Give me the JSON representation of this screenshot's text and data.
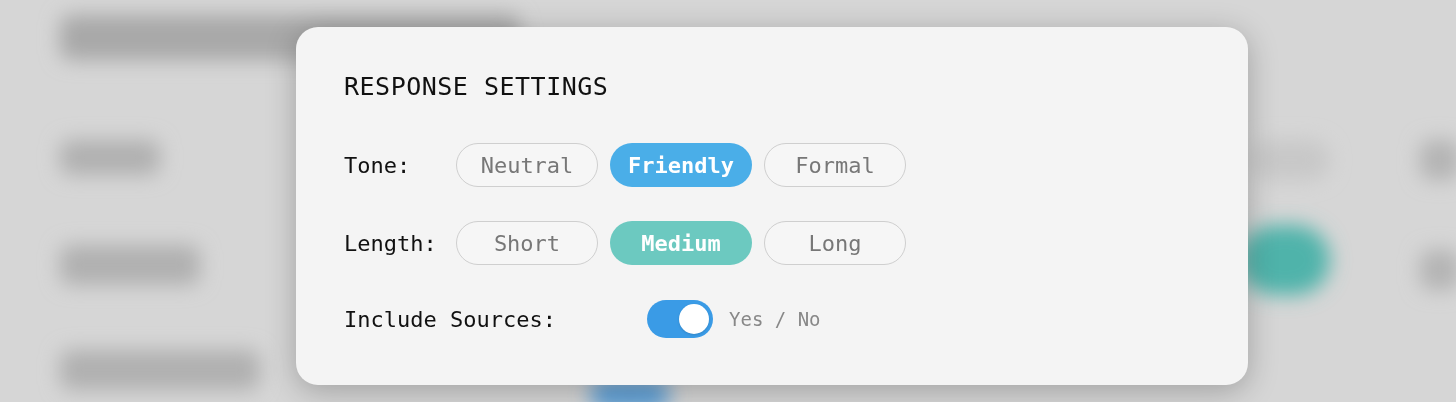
{
  "title": "RESPONSE SETTINGS",
  "groups": [
    {
      "label": "Tone:",
      "color": "#4aaee8",
      "options": [
        {
          "label": "Neutral",
          "selected": false
        },
        {
          "label": "Friendly",
          "selected": true
        },
        {
          "label": "Formal",
          "selected": false
        }
      ]
    },
    {
      "label": "Length:",
      "color": "#6cc9c0",
      "options": [
        {
          "label": "Short",
          "selected": false
        },
        {
          "label": "Medium",
          "selected": true
        },
        {
          "label": "Long",
          "selected": false
        }
      ]
    }
  ],
  "toggle": {
    "label": "Include Sources:",
    "on": true,
    "hint": "Yes / No"
  }
}
